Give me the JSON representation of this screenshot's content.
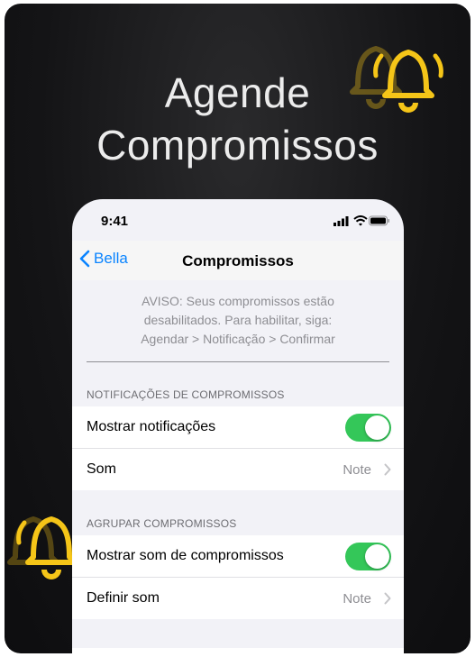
{
  "hero": {
    "line1": "Agende",
    "line2": "Compromissos"
  },
  "status_bar": {
    "time": "9:41"
  },
  "nav": {
    "back_label": "Bella",
    "title": "Compromissos"
  },
  "notice": {
    "line1": "AVISO: Seus compromissos estão",
    "line2": "desabilitados. Para habilitar, siga:",
    "line3": "Agendar > Notificação > Confirmar"
  },
  "sections": [
    {
      "header": "NOTIFICAÇÕES DE COMPROMISSOS",
      "rows": [
        {
          "label": "Mostrar notificações",
          "toggle": true
        },
        {
          "label": "Som",
          "value": "Note"
        }
      ]
    },
    {
      "header": "AGRUPAR COMPROMISSOS",
      "rows": [
        {
          "label": "Mostrar som de compromissos",
          "toggle": true
        },
        {
          "label": "Definir som",
          "value": "Note"
        }
      ]
    }
  ],
  "colors": {
    "toggle_on": "#34c759",
    "accent": "#0a84ff",
    "bell": "#f5c518"
  },
  "icons": [
    "bell-icon",
    "signal-icon",
    "wifi-icon",
    "battery-icon",
    "chevron-left-icon",
    "chevron-right-icon"
  ]
}
